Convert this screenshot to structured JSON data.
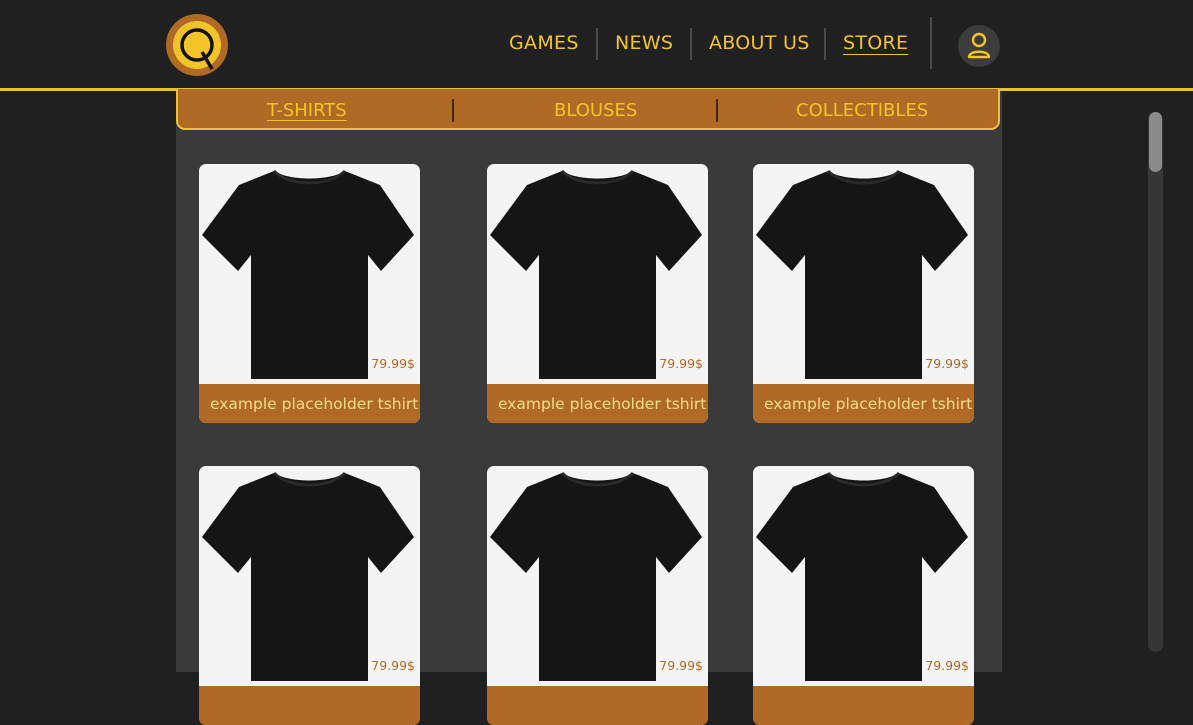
{
  "header": {
    "logo_letter": "Q",
    "nav": [
      {
        "label": "GAMES",
        "active": false
      },
      {
        "label": "NEWS",
        "active": false
      },
      {
        "label": "ABOUT US",
        "active": false
      },
      {
        "label": "STORE",
        "active": true
      }
    ]
  },
  "subnav": {
    "items": [
      {
        "label": "T-SHIRTS",
        "active": true
      },
      {
        "label": "BLOUSES",
        "active": false
      },
      {
        "label": "COLLECTIBLES",
        "active": false
      }
    ]
  },
  "products": [
    {
      "name": "example placeholder tshirt",
      "price": "79.99$"
    },
    {
      "name": "example placeholder tshirt",
      "price": "79.99$"
    },
    {
      "name": "example placeholder tshirt",
      "price": "79.99$"
    },
    {
      "name": "",
      "price": "79.99$"
    },
    {
      "name": "",
      "price": "79.99$"
    },
    {
      "name": "",
      "price": "79.99$"
    }
  ],
  "colors": {
    "accent": "#f2c42a",
    "brand": "#b06a25",
    "background": "#202020",
    "panel": "#3a3a3a"
  },
  "icons": {
    "logo": "q-logo-icon",
    "user": "user-icon",
    "product_image": "tshirt-icon"
  }
}
